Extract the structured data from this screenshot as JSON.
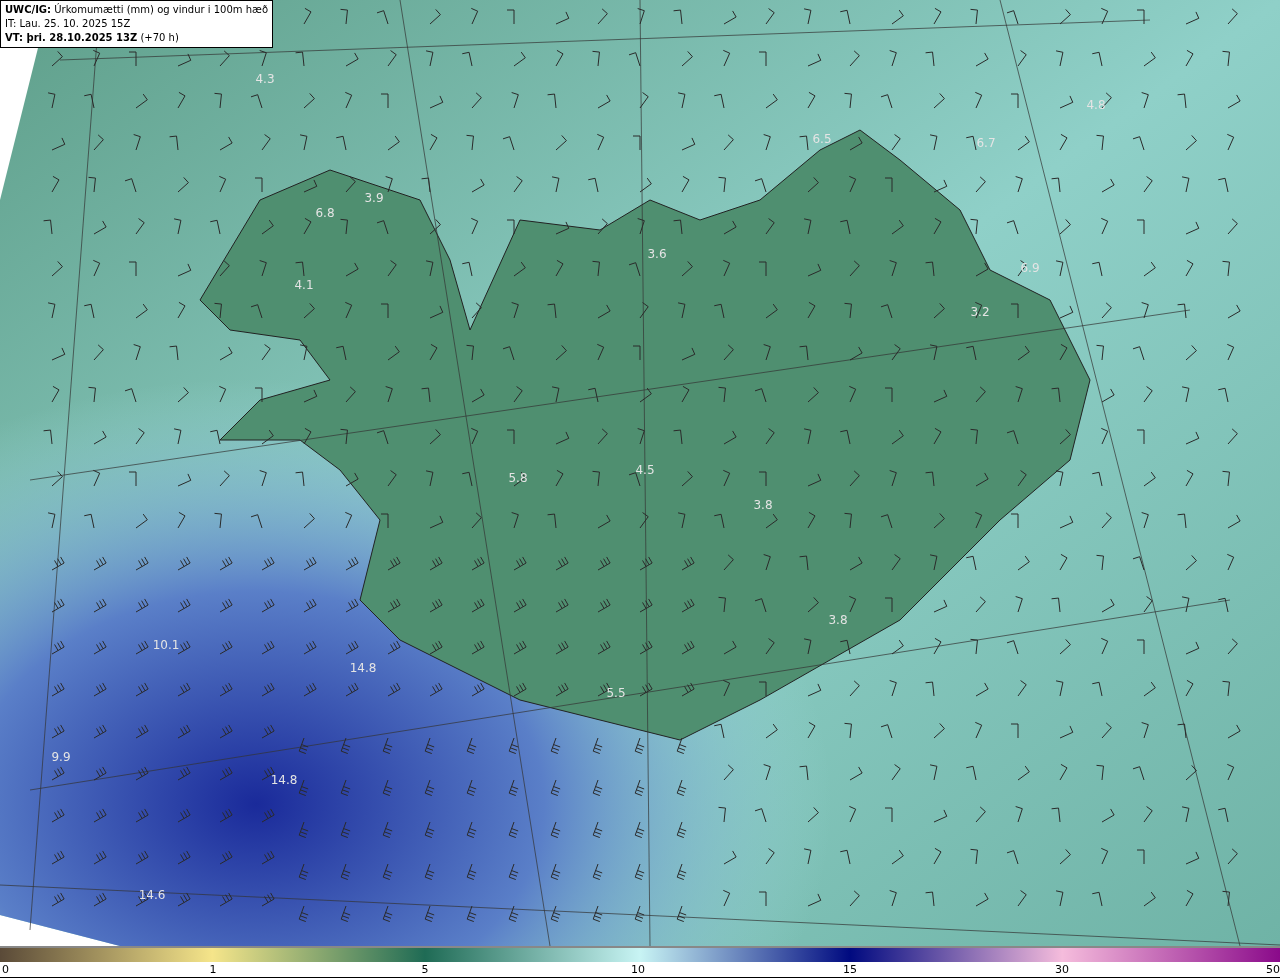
{
  "header": {
    "lines": [
      "**UWC/IG:** Úrkomumætti (mm) og vindur i 100m hæð",
      "IT: Lau. 25. 10. 2025 15Z",
      "**VT: þri. 28.10.2025 13Z** (+70 h)"
    ]
  },
  "map_labels": [
    "4.3",
    "4.8",
    "6.5",
    "6.7",
    "3.9",
    "6.8",
    "3.6",
    "6.9",
    "4.1",
    "3.2",
    "4.5",
    "5.8",
    "3.8",
    "3.8",
    "10.1",
    "14.8",
    "5.5",
    "9.9",
    "14.8",
    "14.6"
  ],
  "colorbar": {
    "ticks": [
      "0",
      "1",
      "5",
      "10",
      "15",
      "30",
      "50"
    ]
  }
}
